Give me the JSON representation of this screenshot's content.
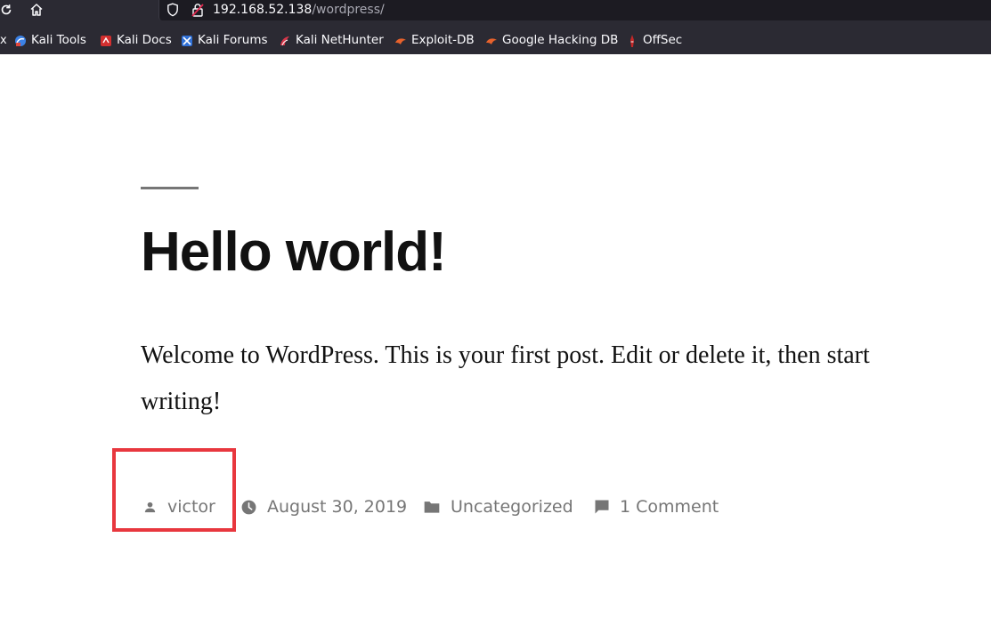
{
  "browser": {
    "url_host": "192.168.52.138",
    "url_path": "/wordpress/",
    "bookmarks_cut_label": "x",
    "bookmarks": [
      {
        "label": "Kali Tools",
        "icon": "kali-tools-icon"
      },
      {
        "label": "Kali Docs",
        "icon": "kali-docs-icon"
      },
      {
        "label": "Kali Forums",
        "icon": "kali-forums-icon"
      },
      {
        "label": "Kali NetHunter",
        "icon": "kali-nethunter-icon"
      },
      {
        "label": "Exploit-DB",
        "icon": "exploit-db-icon"
      },
      {
        "label": "Google Hacking DB",
        "icon": "google-hacking-db-icon"
      },
      {
        "label": "OffSec",
        "icon": "offsec-icon"
      }
    ]
  },
  "post": {
    "title": "Hello world!",
    "content": "Welcome to WordPress. This is your first post. Edit or delete it, then start writing!",
    "meta": {
      "author": "victor",
      "date": "August 30, 2019",
      "category": "Uncategorized",
      "comments": "1 Comment"
    }
  },
  "colors": {
    "chrome_bg": "#2b2a33",
    "urlbar_bg": "#1c1b22",
    "meta_text": "#767676",
    "highlight_box": "#e8373e"
  }
}
